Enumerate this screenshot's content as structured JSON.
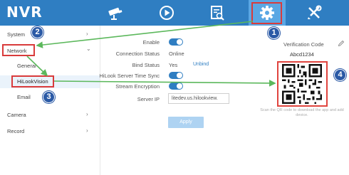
{
  "header": {
    "logo": "NVR",
    "nav": [
      {
        "name": "live-view-camera-icon"
      },
      {
        "name": "playback-icon"
      },
      {
        "name": "search-file-icon"
      },
      {
        "name": "configuration-gear-icon",
        "active": true
      },
      {
        "name": "maintenance-tools-icon"
      }
    ]
  },
  "sidebar": {
    "items": [
      {
        "label": "System",
        "has_chevron": true,
        "chevron": "›"
      },
      {
        "label": "Network",
        "has_chevron": true,
        "chevron": "⌄"
      },
      {
        "label": "General",
        "sub": true
      },
      {
        "label": "HiLookVision",
        "sub": true,
        "selected": true
      },
      {
        "label": "Email",
        "sub": true
      },
      {
        "label": "Camera",
        "has_chevron": true,
        "chevron": "›"
      },
      {
        "label": "Record",
        "has_chevron": true,
        "chevron": "›"
      }
    ]
  },
  "form": {
    "enable_label": "Enable",
    "enable_value": true,
    "connection_status_label": "Connection Status",
    "connection_status_value": "Online",
    "bind_status_label": "Bind Status",
    "bind_status_value": "Yes",
    "unbind_link": "Unbind",
    "time_sync_label": "HiLook Server Time Sync",
    "time_sync_value": true,
    "stream_encryption_label": "Stream Encryption",
    "stream_encryption_value": true,
    "server_ip_label": "Server IP",
    "server_ip_value": "litedev.us.hilookview.",
    "apply_label": "Apply"
  },
  "verification": {
    "label": "Verification Code",
    "code": "Abcd1234",
    "scan_hint": "Scan the QR code to download the app and add device."
  },
  "annotations": {
    "callouts": [
      "1",
      "2",
      "3",
      "4"
    ],
    "highlight_color": "#d93b3b",
    "arrow_color": "#5cb85c",
    "callout_color": "#2b5aa6"
  },
  "colors": {
    "header_bg": "#2f7ec2",
    "accent": "#2f7ec2"
  }
}
